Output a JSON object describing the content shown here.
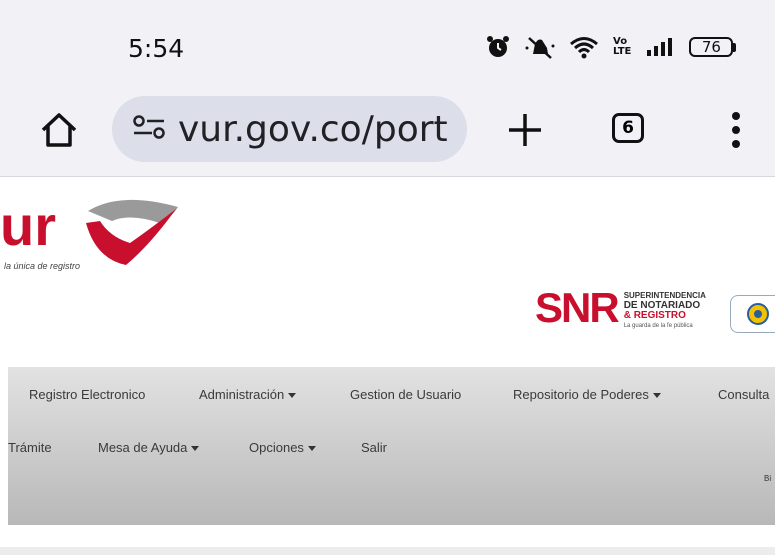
{
  "status": {
    "time": "5:54",
    "battery": "76",
    "network_label_top": "Vo",
    "network_label_bottom": "LTE"
  },
  "browser": {
    "url": "vur.gov.co/port",
    "tab_count": "6"
  },
  "header": {
    "logo_text": "ur",
    "tagline": "la única de registro",
    "snr": {
      "letters": "SNR",
      "line1": "SUPERINTENDENCIA",
      "line2": "DE NOTARIADO",
      "line3": "& REGISTRO",
      "line4": "La guarda de la fe pública"
    }
  },
  "nav": {
    "row1": [
      "Registro Electronico",
      "Administración",
      "Gestion de Usuario",
      "Repositorio de Poderes",
      "Consulta"
    ],
    "row2": [
      "Trámite",
      "Mesa de Ayuda",
      "Opciones",
      "Salir"
    ],
    "tiny": "Bi"
  },
  "colors": {
    "brand_red": "#c8102e",
    "url_pill": "#dcdfe9",
    "browser_bg": "#f1f1f6"
  }
}
